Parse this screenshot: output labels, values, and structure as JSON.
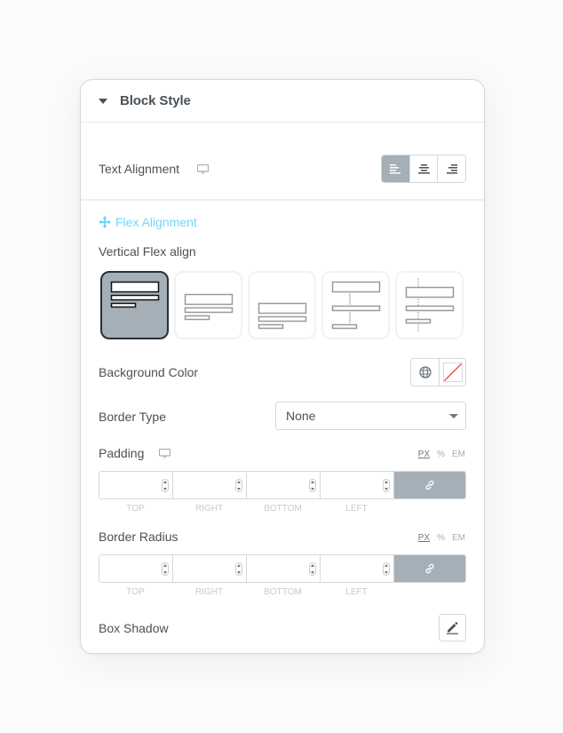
{
  "panel": {
    "title": "Block Style"
  },
  "text_alignment": {
    "label": "Text Alignment",
    "responsive_icon": "monitor-icon",
    "options": [
      {
        "name": "left",
        "icon": "align-left-icon",
        "active": true
      },
      {
        "name": "center",
        "icon": "align-center-icon",
        "active": false
      },
      {
        "name": "right",
        "icon": "align-right-icon",
        "active": false
      }
    ]
  },
  "flex_alignment": {
    "title": "Flex Alignment",
    "icon": "move-arrows-icon",
    "vertical_label": "Vertical Flex align",
    "options": [
      {
        "name": "flex-start",
        "active": true
      },
      {
        "name": "center",
        "active": false
      },
      {
        "name": "flex-end",
        "active": false
      },
      {
        "name": "space-between",
        "active": false
      },
      {
        "name": "space-around",
        "active": false
      }
    ]
  },
  "background_color": {
    "label": "Background Color",
    "global_icon": "globe-icon",
    "value": "none"
  },
  "border_type": {
    "label": "Border Type",
    "selected": "None"
  },
  "padding": {
    "label": "Padding",
    "responsive_icon": "monitor-icon",
    "units": [
      "PX",
      "%",
      "EM"
    ],
    "active_unit": "PX",
    "fields": [
      {
        "label": "TOP",
        "value": ""
      },
      {
        "label": "RIGHT",
        "value": ""
      },
      {
        "label": "BOTTOM",
        "value": ""
      },
      {
        "label": "LEFT",
        "value": ""
      }
    ],
    "linked": true
  },
  "border_radius": {
    "label": "Border Radius",
    "units": [
      "PX",
      "%",
      "EM"
    ],
    "active_unit": "PX",
    "fields": [
      {
        "label": "TOP",
        "value": ""
      },
      {
        "label": "RIGHT",
        "value": ""
      },
      {
        "label": "BOTTOM",
        "value": ""
      },
      {
        "label": "LEFT",
        "value": ""
      }
    ],
    "linked": true
  },
  "box_shadow": {
    "label": "Box Shadow",
    "edit_icon": "pencil-icon"
  },
  "colors": {
    "accent": "#71d7f7",
    "active_bg": "#a4afb7",
    "text": "#495157",
    "swatch_none_line": "#e3342f"
  }
}
